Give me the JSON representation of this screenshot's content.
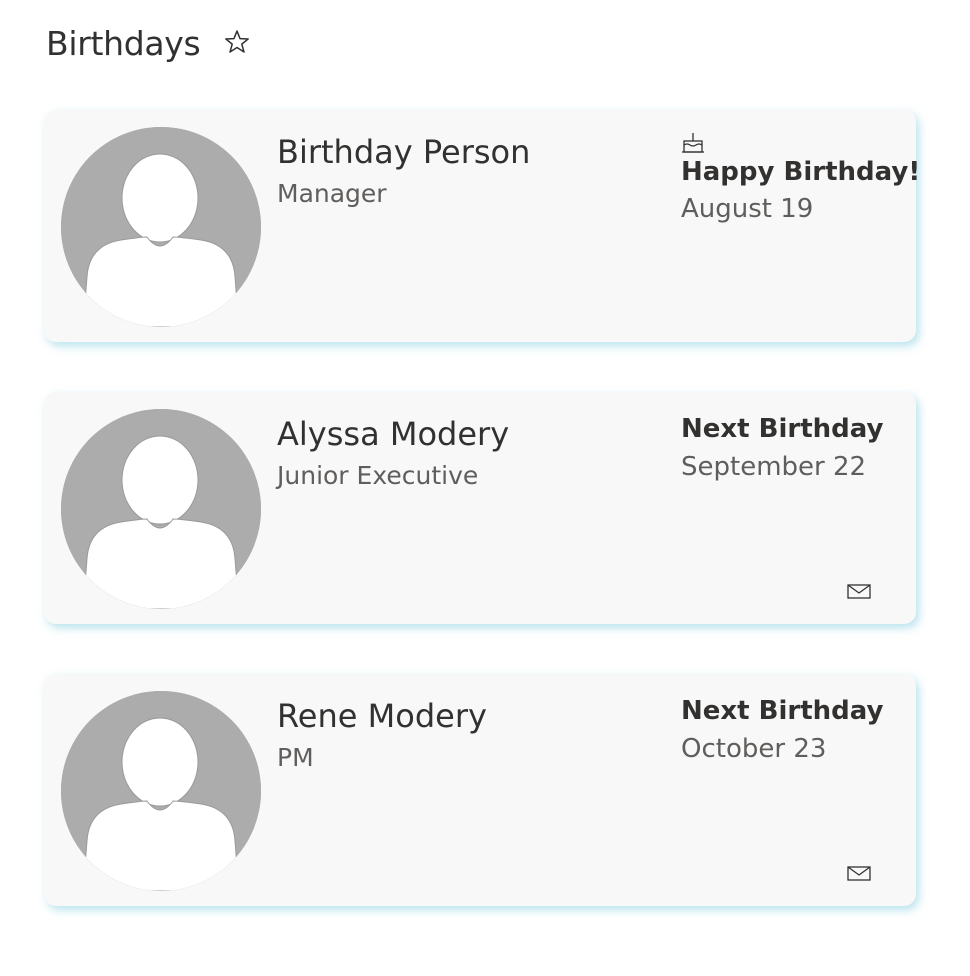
{
  "header": {
    "title": "Birthdays",
    "favorite_icon": "star-outline-icon"
  },
  "people": [
    {
      "name": "Birthday Person",
      "job_title": "Manager",
      "birthday_label": "Happy Birthday!",
      "birthday_date": "August 19",
      "is_today": true,
      "icon": "birthday-cake-icon"
    },
    {
      "name": "Alyssa Modery",
      "job_title": "Junior Executive",
      "birthday_label": "Next Birthday",
      "birthday_date": "September 22",
      "is_today": false,
      "icon": "mail-icon"
    },
    {
      "name": "Rene Modery",
      "job_title": "PM",
      "birthday_label": "Next Birthday",
      "birthday_date": "October 23",
      "is_today": false,
      "icon": "mail-icon"
    }
  ],
  "colors": {
    "card_background": "#f8f8f8",
    "avatar_background": "#acacac",
    "card_shadow": "#80ccde",
    "primary_text": "#323130",
    "secondary_text": "#605e5c"
  }
}
